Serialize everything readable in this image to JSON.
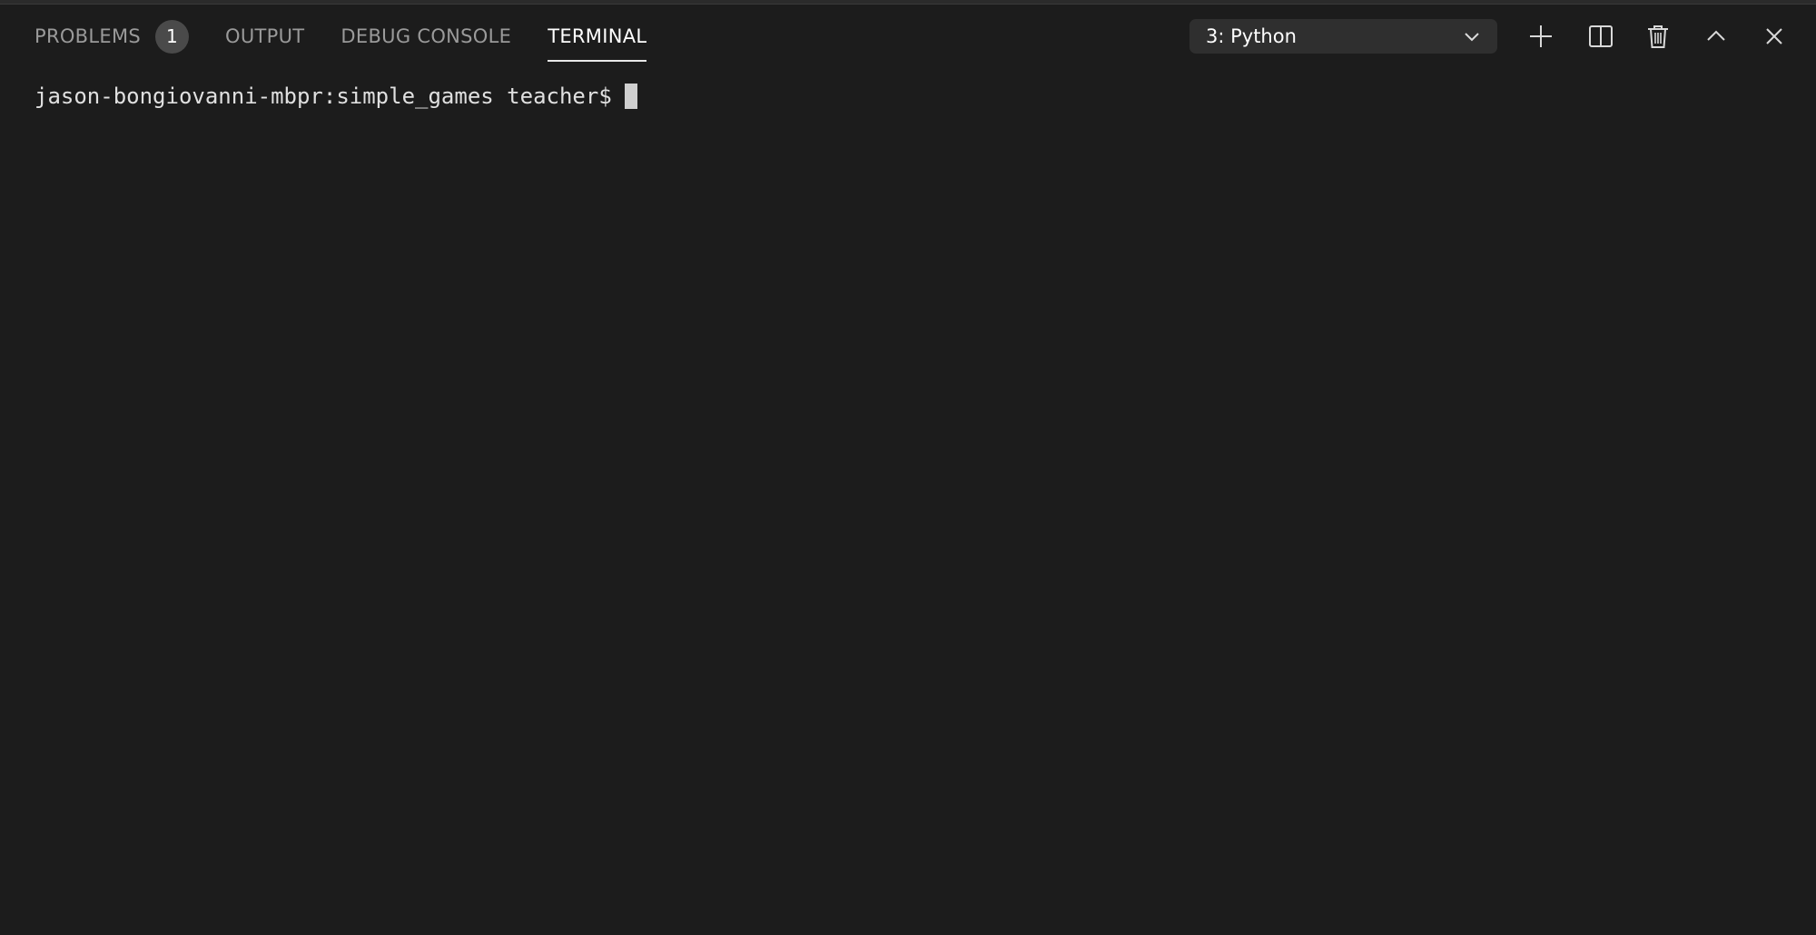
{
  "panel": {
    "tabs": [
      {
        "label": "PROBLEMS",
        "badge": "1",
        "active": false
      },
      {
        "label": "OUTPUT",
        "active": false
      },
      {
        "label": "DEBUG CONSOLE",
        "active": false
      },
      {
        "label": "TERMINAL",
        "active": true
      }
    ],
    "terminal_selector": {
      "selected": "3: Python"
    },
    "actions": [
      {
        "icon": "plus-icon"
      },
      {
        "icon": "split-icon"
      },
      {
        "icon": "trash-icon"
      },
      {
        "icon": "chevron-up-icon"
      },
      {
        "icon": "close-icon"
      }
    ]
  },
  "terminal": {
    "prompt": "jason-bongiovanni-mbpr:simple_games teacher$"
  },
  "colors": {
    "background": "#1c1c1c",
    "tab_inactive": "#9a9a9a",
    "tab_active": "#ffffff",
    "badge_bg": "#4a4a4a",
    "selector_bg": "#2f2f2f"
  }
}
